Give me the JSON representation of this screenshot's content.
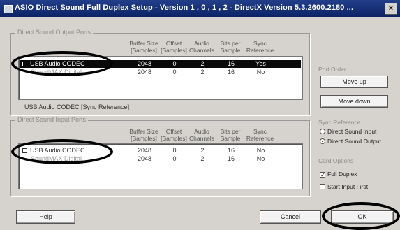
{
  "window": {
    "title": "ASIO Direct Sound Full Duplex Setup   -  Version 1 , 0 , 1 , 2  -  DirectX Version 5.3.2600.2180 ...",
    "close": "×"
  },
  "output_group": {
    "label": "Direct Sound Output Ports",
    "headers": {
      "buffer": [
        "Buffer Size",
        "[Samples]"
      ],
      "offset": [
        "Offset",
        "[Samples]"
      ],
      "channels": [
        "Audio",
        "Channels"
      ],
      "bits": [
        "Bits per",
        "Sample"
      ],
      "sync": [
        "Sync",
        "Reference"
      ]
    },
    "rows": [
      {
        "name": "USB Audio CODEC",
        "buffer": "2048",
        "offset": "0",
        "channels": "2",
        "bits": "16",
        "sync": "Yes"
      },
      {
        "name": "SoundMAX Digital ...",
        "buffer": "2048",
        "offset": "0",
        "channels": "2",
        "bits": "16",
        "sync": "No"
      }
    ],
    "status": "USB Audio CODEC  [Sync Reference]"
  },
  "input_group": {
    "label": "Direct Sound Input Ports",
    "headers": {
      "buffer": [
        "Buffer Size",
        "[Samples]"
      ],
      "offset": [
        "Offset",
        "[Samples]"
      ],
      "channels": [
        "Audio",
        "Channels"
      ],
      "bits": [
        "Bits per",
        "Sample"
      ],
      "sync": [
        "Sync",
        "Reference"
      ]
    },
    "rows": [
      {
        "name": "USB Audio CODEC",
        "buffer": "2048",
        "offset": "0",
        "channels": "2",
        "bits": "16",
        "sync": "No"
      },
      {
        "name": "SoundMAX Digital ...",
        "buffer": "2048",
        "offset": "0",
        "channels": "2",
        "bits": "16",
        "sync": "No"
      }
    ]
  },
  "port_order": {
    "label": "Port Order",
    "move_up": "Move up",
    "move_down": "Move down"
  },
  "sync_reference": {
    "label": "Sync Reference",
    "options": [
      "Direct Sound Input",
      "Direct Sound Output"
    ],
    "selected": "Direct Sound Output"
  },
  "card_options": {
    "label": "Card Options",
    "full_duplex": "Full Duplex",
    "full_duplex_checked": true,
    "start_input_first": "Start Input First",
    "start_input_first_checked": false
  },
  "buttons": {
    "help": "Help",
    "cancel": "Cancel",
    "ok": "OK"
  },
  "colors": {
    "title_bar": "#1b3478",
    "selection": "#0a0a0a",
    "annotation": "#000000"
  }
}
